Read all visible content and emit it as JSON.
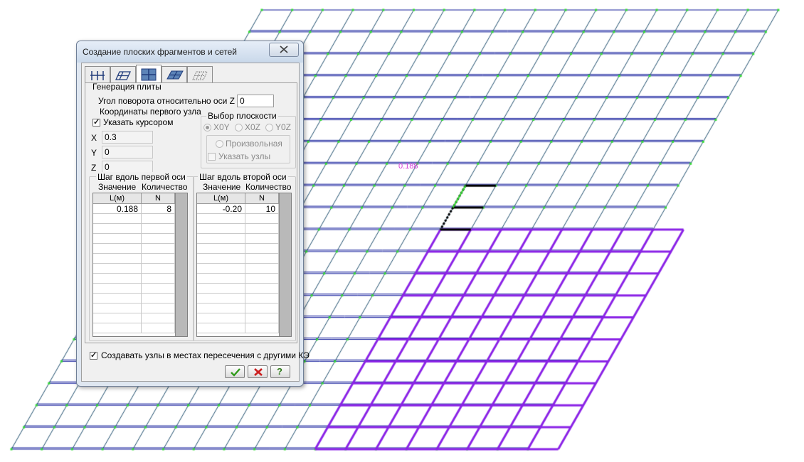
{
  "dialog": {
    "title": "Создание плоских фрагментов и сетей",
    "tabs": [
      {
        "icon": "grid-frame-icon",
        "active": false
      },
      {
        "icon": "skewed-plate-icon",
        "active": false
      },
      {
        "icon": "plate-grid-icon",
        "active": true
      },
      {
        "icon": "skewed-grid-icon",
        "active": false
      },
      {
        "icon": "hatched-mesh-icon",
        "active": false
      }
    ],
    "group_title": "Генерация плиты",
    "rotation": {
      "label": "Угол поворота относительно оси Z",
      "value": "0"
    },
    "first_node": {
      "label": "Координаты первого узла",
      "cursor_checkbox": {
        "label": "Указать курсором",
        "checked": true
      },
      "x_label": "X",
      "x_value": "0.3",
      "y_label": "Y",
      "y_value": "0",
      "z_label": "Z",
      "z_value": "0"
    },
    "plane": {
      "label": "Выбор плоскости",
      "options": [
        "X0Y",
        "X0Z",
        "Y0Z"
      ],
      "selected": "X0Y",
      "arbitrary_label": "Произвольная",
      "nodes_label": "Указать узлы"
    },
    "step1": {
      "title": "Шаг вдоль первой оси",
      "value_label": "Значение",
      "count_label": "Количество",
      "col_l": "L(м)",
      "col_n": "N",
      "rows": [
        {
          "l": "0.188",
          "n": "8"
        }
      ]
    },
    "step2": {
      "title": "Шаг вдоль второй оси",
      "value_label": "Значение",
      "count_label": "Количество",
      "col_l": "L(м)",
      "col_n": "N",
      "rows": [
        {
          "l": "-0.20",
          "n": "10"
        }
      ]
    },
    "intersect_checkbox": {
      "label": "Создавать узлы в местах пересечения с другими КЭ",
      "checked": true
    },
    "buttons": {
      "ok": "ok-checkmark",
      "cancel": "cancel-x",
      "help": "?"
    }
  },
  "viewport": {
    "preview_label": "0.188",
    "colors": {
      "mesh_blue": "#101a9a",
      "mesh_purple": "#8a22e6",
      "node_green": "#33dd33",
      "label_magenta": "#d63bd6"
    }
  }
}
